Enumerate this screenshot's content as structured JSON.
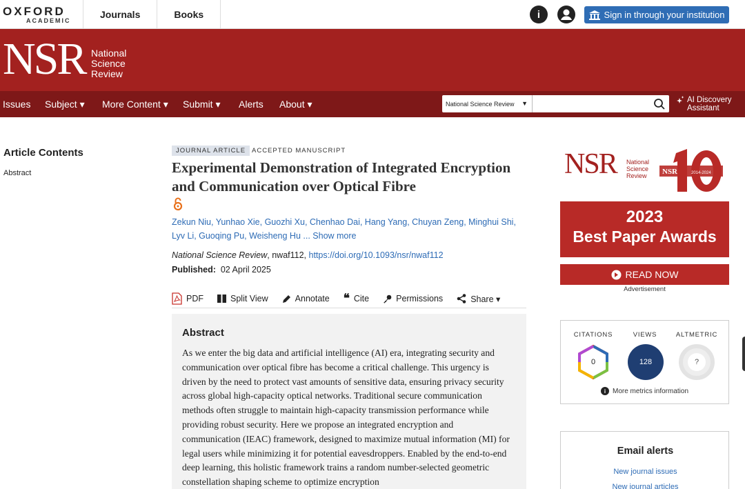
{
  "header": {
    "brand_line1": "OXFORD",
    "brand_line2": "ACADEMIC",
    "nav": [
      "Journals",
      "Books"
    ],
    "info_icon": "info-icon",
    "account_icon": "account-icon",
    "signin_label": "Sign in through your institution"
  },
  "journal": {
    "logo": "NSR",
    "name_line1": "National",
    "name_line2": "Science",
    "name_line3": "Review",
    "brand_color": "#a3211f"
  },
  "mainnav": {
    "items": [
      "Issues",
      "Subject ▾",
      "More Content ▾",
      "Submit ▾",
      "Alerts",
      "About ▾"
    ],
    "search_scope": "National Science Review",
    "search_placeholder": "",
    "ai_label_line1": "AI Discovery",
    "ai_label_line2": "Assistant"
  },
  "sidebar": {
    "title": "Article Contents",
    "items": [
      "Abstract"
    ]
  },
  "article": {
    "type_badge": "JOURNAL ARTICLE",
    "status": "ACCEPTED MANUSCRIPT",
    "title": "Experimental Demonstration of Integrated Encryption and Communication over Optical Fibre",
    "authors": "Zekun Niu, Yunhao Xie, Guozhi Xu, Chenhao Dai, Hang Yang, Chuyan Zeng, Minghui Shi, Lyv Li, Guoqing Pu, Weisheng Hu ... Show more",
    "journal_name": "National Science Review",
    "article_id": ", nwaf112, ",
    "doi": "https://doi.org/10.1093/nsr/nwaf112",
    "published_label": "Published:",
    "published_date": "02 April 2025",
    "tools": {
      "pdf": "PDF",
      "split": "Split View",
      "annotate": "Annotate",
      "cite": "Cite",
      "permissions": "Permissions",
      "share": "Share ▾"
    }
  },
  "abstract": {
    "heading": "Abstract",
    "text": "As we enter the big data and artificial intelligence (AI) era, integrating security and communication over optical fibre has become a critical challenge. This urgency is driven by the need to protect vast amounts of sensitive data, ensuring privacy security across global high-capacity optical networks. Traditional secure communication methods often struggle to maintain high-capacity transmission performance while providing robust security. Here we propose an integrated encryption and communication (IEAC) framework, designed to maximize mutual information (MI) for legal users while minimizing it for potential eavesdroppers. Enabled by the end-to-end deep learning, this holistic framework trains a random number-selected geometric constellation shaping scheme to optimize encryption"
  },
  "ad": {
    "ad_logo": "NSR",
    "ad_sub1": "National",
    "ad_sub2": "Science",
    "ad_sub3": "Review",
    "anniversary_years": "2014-2024",
    "year": "2023",
    "headline": "Best Paper Awards",
    "cta": "READ NOW",
    "label": "Advertisement"
  },
  "metrics": {
    "citations_label": "CITATIONS",
    "views_label": "VIEWS",
    "altmetric_label": "ALTMETRIC",
    "citations": "0",
    "views": "128",
    "altmetric": "?",
    "views_color": "#1f3e72",
    "more": "More metrics information"
  },
  "email": {
    "heading": "Email alerts",
    "link1": "New journal issues",
    "link2": "New journal articles"
  }
}
